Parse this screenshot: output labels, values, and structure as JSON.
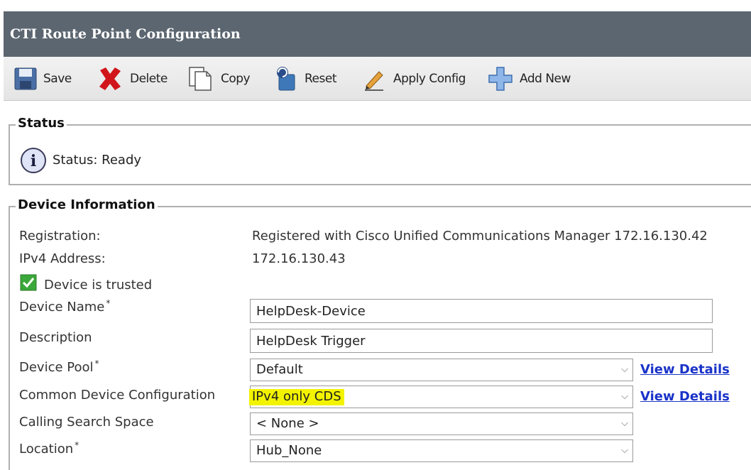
{
  "window": {
    "title": "CTI Route Point Configuration"
  },
  "toolbar": {
    "save": "Save",
    "delete": "Delete",
    "copy": "Copy",
    "reset": "Reset",
    "apply_config": "Apply Config",
    "add_new": "Add New"
  },
  "status": {
    "legend": "Status",
    "text": "Status: Ready"
  },
  "device_info": {
    "legend": "Device Information",
    "registration_label": "Registration:",
    "registration_value": "Registered with Cisco Unified Communications Manager 172.16.130.42",
    "ipv4_label": "IPv4 Address:",
    "ipv4_value": "172.16.130.43",
    "trusted_text": "Device is trusted",
    "device_name_label": "Device Name",
    "device_name_value": "HelpDesk-Device",
    "description_label": "Description",
    "description_value": "HelpDesk Trigger",
    "device_pool_label": "Device Pool",
    "device_pool_value": "Default",
    "cdc_label": "Common Device Configuration",
    "cdc_value": "IPv4 only CDS",
    "css_label": "Calling Search Space",
    "css_value": "< None >",
    "location_label": "Location",
    "location_value": "Hub_None",
    "view_details": "View Details",
    "required_mark": "*"
  },
  "colors": {
    "title_bg": "#5c6670",
    "link": "#1a33c8",
    "highlight": "#f3f300",
    "check_green": "#3aa83a"
  }
}
